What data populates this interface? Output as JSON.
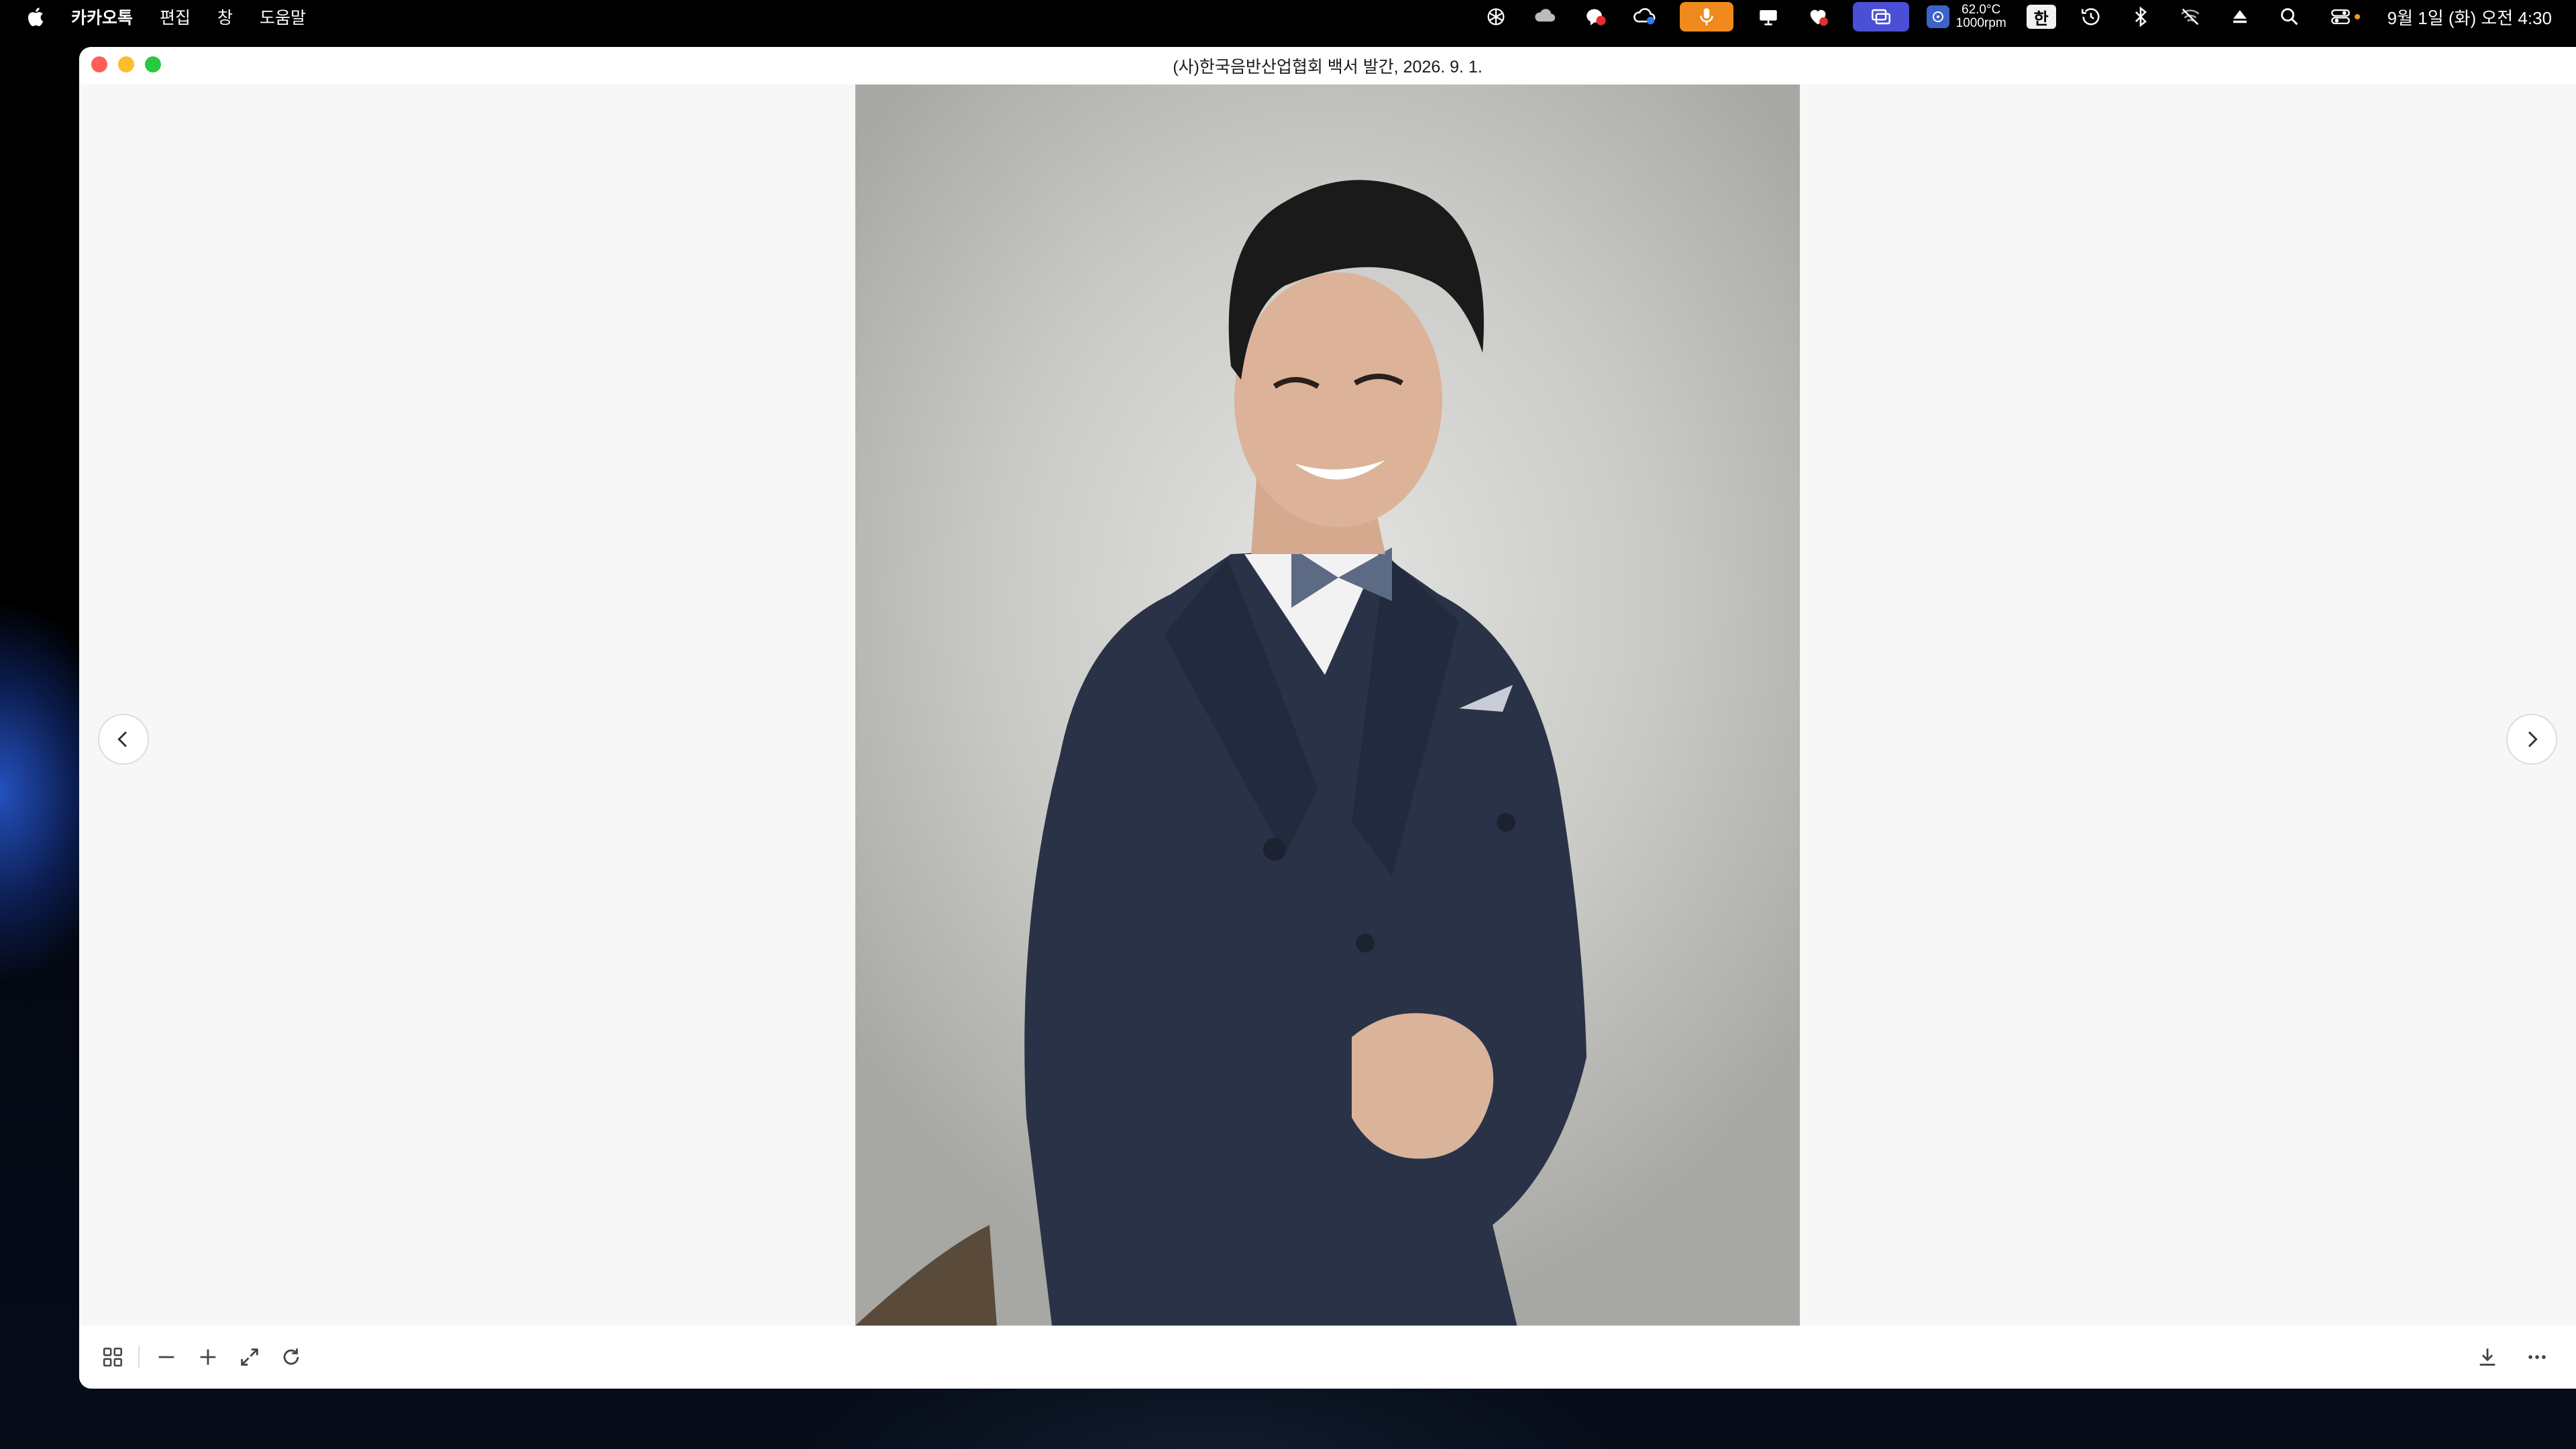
{
  "menubar": {
    "app_name": "카카오톡",
    "menus": [
      "편집",
      "창",
      "도움말"
    ],
    "temperature": "62.0°C",
    "fan_speed": "1000rpm",
    "input_method": "한",
    "clock": "9월 1일 (화) 오전 4:30"
  },
  "window": {
    "title": "(사)한국음반산업협회 백서 발간, 2026. 9. 1."
  },
  "colors": {
    "mic_accent": "#f08a1c",
    "mirror_accent": "#4a4fd6",
    "close": "#fe5f57",
    "minimize": "#febc2e",
    "maximize": "#28c840"
  }
}
